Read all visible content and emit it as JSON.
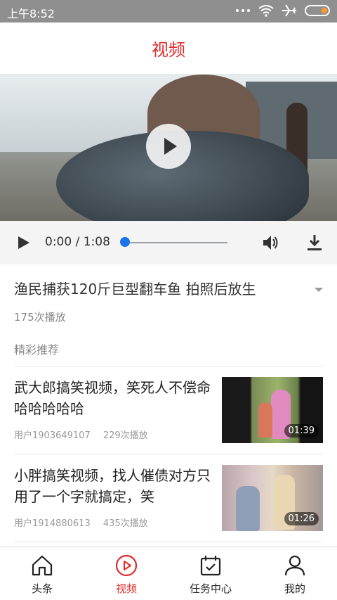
{
  "status_bar": {
    "time": "上午8:52",
    "icons": [
      "dots-icon",
      "wifi-icon",
      "airplane-icon",
      "battery-icon"
    ]
  },
  "header": {
    "title": "视频"
  },
  "player": {
    "time_display": "0:00 / 1:08",
    "progress": 0.0,
    "controls": [
      "play-icon",
      "volume-icon",
      "download-icon"
    ]
  },
  "video": {
    "title": "渔民捕获120斤巨型翻车鱼 拍照后放生",
    "play_count": "175次播放"
  },
  "recommend": {
    "label": "精彩推荐",
    "items": [
      {
        "title": "武大郎搞笑视频，笑死人不偿命哈哈哈哈哈",
        "user": "用户1903649107",
        "plays": "229次播放",
        "duration": "01:39"
      },
      {
        "title": "小胖搞笑视频，找人催债对方只用了一个字就搞定，笑",
        "user": "用户1914880613",
        "plays": "435次播放",
        "duration": "01:26"
      }
    ]
  },
  "tabs": [
    {
      "label": "头条",
      "icon": "home-icon",
      "active": false
    },
    {
      "label": "视频",
      "icon": "play-circle-icon",
      "active": true
    },
    {
      "label": "任务中心",
      "icon": "calendar-check-icon",
      "active": false
    },
    {
      "label": "我的",
      "icon": "user-icon",
      "active": false
    }
  ],
  "colors": {
    "accent": "#e02b2b",
    "progress": "#1a73e8",
    "battery": "#ff9a2a"
  }
}
